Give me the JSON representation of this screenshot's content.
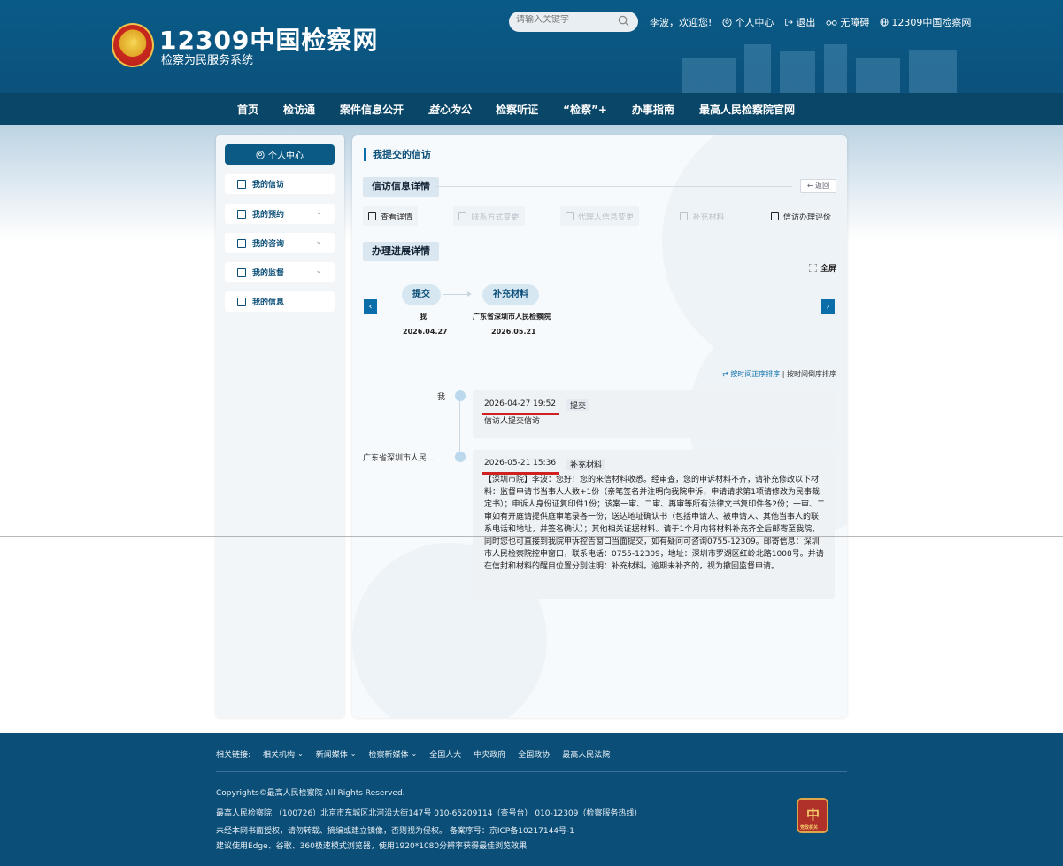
{
  "header": {
    "logo_title": "12309中国检察网",
    "logo_subtitle": "检察为民服务系统",
    "search_placeholder": "请输入关键字",
    "greeting": "李波，欢迎您!",
    "personal_center": "个人中心",
    "logout": "退出",
    "accessibility": "无障碍",
    "site_link": "12309中国检察网"
  },
  "nav": {
    "items": [
      "首页",
      "检访通",
      "案件信息公开",
      "益心为公",
      "检察听证",
      "“检察”+",
      "办事指南",
      "最高人民检察院官网"
    ]
  },
  "sidebar": {
    "head": "个人中心",
    "items": [
      {
        "label": "我的信访"
      },
      {
        "label": "我的预约"
      },
      {
        "label": "我的咨询"
      },
      {
        "label": "我的监督"
      },
      {
        "label": "我的信息"
      }
    ]
  },
  "main": {
    "title": "我提交的信访",
    "section1": "信访信息详情",
    "back": "← 返回",
    "tabs": [
      {
        "label": "查看详情",
        "enabled": true
      },
      {
        "label": "联系方式变更",
        "enabled": false
      },
      {
        "label": "代理人信息变更",
        "enabled": false
      },
      {
        "label": "补充材料",
        "enabled": false
      },
      {
        "label": "信访办理评价",
        "enabled": true
      }
    ],
    "section2": "办理进展详情",
    "fullscreen": "全屏",
    "steps": [
      {
        "name": "提交",
        "actor": "我",
        "date": "2026.04.27"
      },
      {
        "name": "补充材料",
        "actor": "广东省深圳市人民检察院",
        "date": "2026.05.21"
      }
    ],
    "sort_asc": "按时间正序排序",
    "sort_desc": "按时间倒序排序",
    "timeline": [
      {
        "who": "我",
        "time": "2026-04-27 19:52",
        "status": "提交",
        "content": "信访人提交信访"
      },
      {
        "who": "广东省深圳市人民...",
        "time": "2026-05-21 15:36",
        "status": "补充材料",
        "content": "【深圳市院】李波：您好！您的来信材料收悉。经审查，您的申诉材料不齐，请补充修改以下材料：监督申请书当事人人数+1份（亲笔签名并注明向我院申诉，申请请求第1项请修改为民事裁定书）；申诉人身份证复印件1份；该案一审、二审、再审等所有法律文书复印件各2份；一审、二审如有开庭请提供庭审笔录各一份；送达地址确认书（包括申请人、被申请人、其他当事人的联系电话和地址，并签名确认）；其他相关证据材料。请于1个月内将材料补充齐全后邮寄至我院，同时您也可直接到我院申诉控告窗口当面提交，如有疑问可咨询0755-12309。邮寄信息：深圳市人民检察院控申窗口，联系电话：0755-12309，地址：深圳市罗湖区红岭北路1008号。并请在信封和材料的醒目位置分别注明：补充材料。逾期未补齐的，视为撤回监督申请。"
      }
    ]
  },
  "footer": {
    "related_label": "相关链接:",
    "links": [
      "相关机构",
      "新闻媒体",
      "检察新媒体",
      "全国人大",
      "中央政府",
      "全国政协",
      "最高人民法院"
    ],
    "copyright": "Copyrights©最高人民检察院 All Rights Reserved.",
    "address": "最高人民检察院 （100726）北京市东城区北河沿大街147号 010-65209114（查号台） 010-12309（检察服务热线）",
    "notice": "未经本网书面授权，请勿转载、摘编或建立镜像，否则视为侵权。 备案序号：京ICP备10217144号-1",
    "browser": "建议使用Edge、谷歌、360极速模式浏览器，使用1920*1080分辨率获得最佳浏览效果",
    "seal_label": "党政机关"
  },
  "colors": {
    "primary": "#0b5a86",
    "nav_bg": "#0a4668",
    "accent_red": "#d02020"
  }
}
